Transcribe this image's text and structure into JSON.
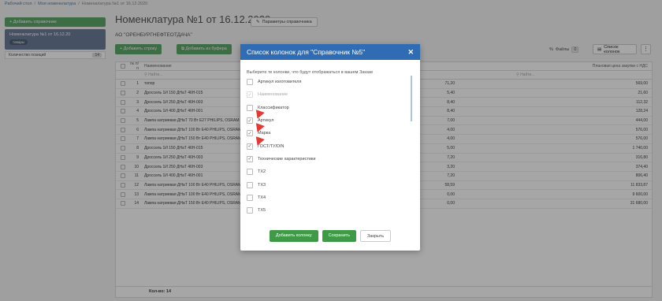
{
  "breadcrumb": [
    "Рабочий стол",
    "Моя номенклатура",
    "Номенклатура №1 от 16.12.2020"
  ],
  "sidebar": {
    "add_label": "+ Добавить справочник",
    "ref_name": "Номенклатура №1 от 16.12.20",
    "ref_tag": "товары",
    "count_label": "Количество позиций",
    "count_value": "14"
  },
  "page": {
    "title": "Номенклатура №1 от 16.12.2020",
    "params_label": "Параметры справочника",
    "org": "АО \"ОРЕНБУРГНЕФТЕОТДАЧА\""
  },
  "toolbar": {
    "add_row": "+ Добавить строку",
    "add_from_buffer": "Добавить из буфера",
    "files_label": "Файлы",
    "files_count": "0",
    "columns_list": "Список колонок"
  },
  "table": {
    "headers": [
      "№ п/п",
      "Наименование",
      "Плановая цена закупки с НДС"
    ],
    "filter_placeholder": "Найти...",
    "rows": [
      {
        "n": "1",
        "name": "топор",
        "mid": "71,20",
        "price": "569,00"
      },
      {
        "n": "2",
        "name": "Дроссель 1И 150 ДНаТ 46Н-015",
        "mid": "5,40",
        "price": "21,60"
      },
      {
        "n": "3",
        "name": "Дроссель 1И 250 ДНаТ 46Н-003",
        "mid": "8,40",
        "price": "112,32"
      },
      {
        "n": "4",
        "name": "Дроссель 1И 400 ДНаТ 46Н-001",
        "mid": "8,40",
        "price": "128,24"
      },
      {
        "n": "5",
        "name": "Лампа натриевая ДНаТ 70 Вт E27 PHILIPS, OSRAM",
        "mid": "7,00",
        "price": "444,00"
      },
      {
        "n": "6",
        "name": "Лампа натриевая ДНаТ 100 Вт E40 PHILIPS, OSRAM",
        "mid": "4,00",
        "price": "576,00"
      },
      {
        "n": "7",
        "name": "Лампа натриевая ДНаТ 150 Вт E40 PHILIPS, OSRAM",
        "mid": "4,00",
        "price": "576,00"
      },
      {
        "n": "8",
        "name": "Дроссель 1И 150 ДНаТ 46Н-015",
        "mid": "5,00",
        "price": "1 740,00"
      },
      {
        "n": "9",
        "name": "Дроссель 1И 250 ДНаТ 46Н-003",
        "mid": "7,20",
        "price": "316,80"
      },
      {
        "n": "10",
        "name": "Дроссель 1И 250 ДНаТ 46Н-003",
        "mid": "3,20",
        "price": "374,40"
      },
      {
        "n": "11",
        "name": "Дроссель 1И 400 ДНаТ 46Н-001",
        "mid": "7,20",
        "price": "806,40"
      },
      {
        "n": "12",
        "name": "Лампа натриевая ДНаТ 100 Вт E40 PHILIPS, OSRAM",
        "mid": "58,59",
        "price": "11 833,87"
      },
      {
        "n": "13",
        "name": "Лампа натриевая ДНаТ 100 Вт E40 PHILIPS, OSRAM",
        "mid": "0,00",
        "price": "9 600,00"
      },
      {
        "n": "14",
        "name": "Лампа натриевая ДНаТ 150 Вт E40 PHILIPS, OSRAM",
        "mid": "0,00",
        "price": "31 680,00"
      }
    ],
    "footer": "Кол-во: 14"
  },
  "modal": {
    "title": "Список колонок для \"Справочник №5\"",
    "description": "Выберите те колонки, что будут отображаться в вашем Заказе",
    "options": [
      {
        "label": "Артикул изготовителя",
        "checked": false,
        "disabled": false
      },
      {
        "label": "Наименование",
        "checked": true,
        "disabled": true
      },
      {
        "label": "Классификатор",
        "checked": false,
        "disabled": false
      },
      {
        "label": "Артикул",
        "checked": true,
        "disabled": false
      },
      {
        "label": "Марка",
        "checked": true,
        "disabled": false
      },
      {
        "label": "ГОСТ/ТУ/DIN",
        "checked": true,
        "disabled": false
      },
      {
        "label": "Технические характеристики",
        "checked": true,
        "disabled": false
      },
      {
        "label": "TX2",
        "checked": false,
        "disabled": false
      },
      {
        "label": "TX3",
        "checked": false,
        "disabled": false
      },
      {
        "label": "TX4",
        "checked": false,
        "disabled": false
      },
      {
        "label": "TX5",
        "checked": false,
        "disabled": false
      }
    ],
    "btn_add_column": "Добавить колонку",
    "btn_save": "Сохранить",
    "btn_close": "Закрыть"
  },
  "colors": {
    "accent_blue": "#2f6cb3",
    "green": "#3f9a48",
    "arrow_red": "#e53935"
  }
}
